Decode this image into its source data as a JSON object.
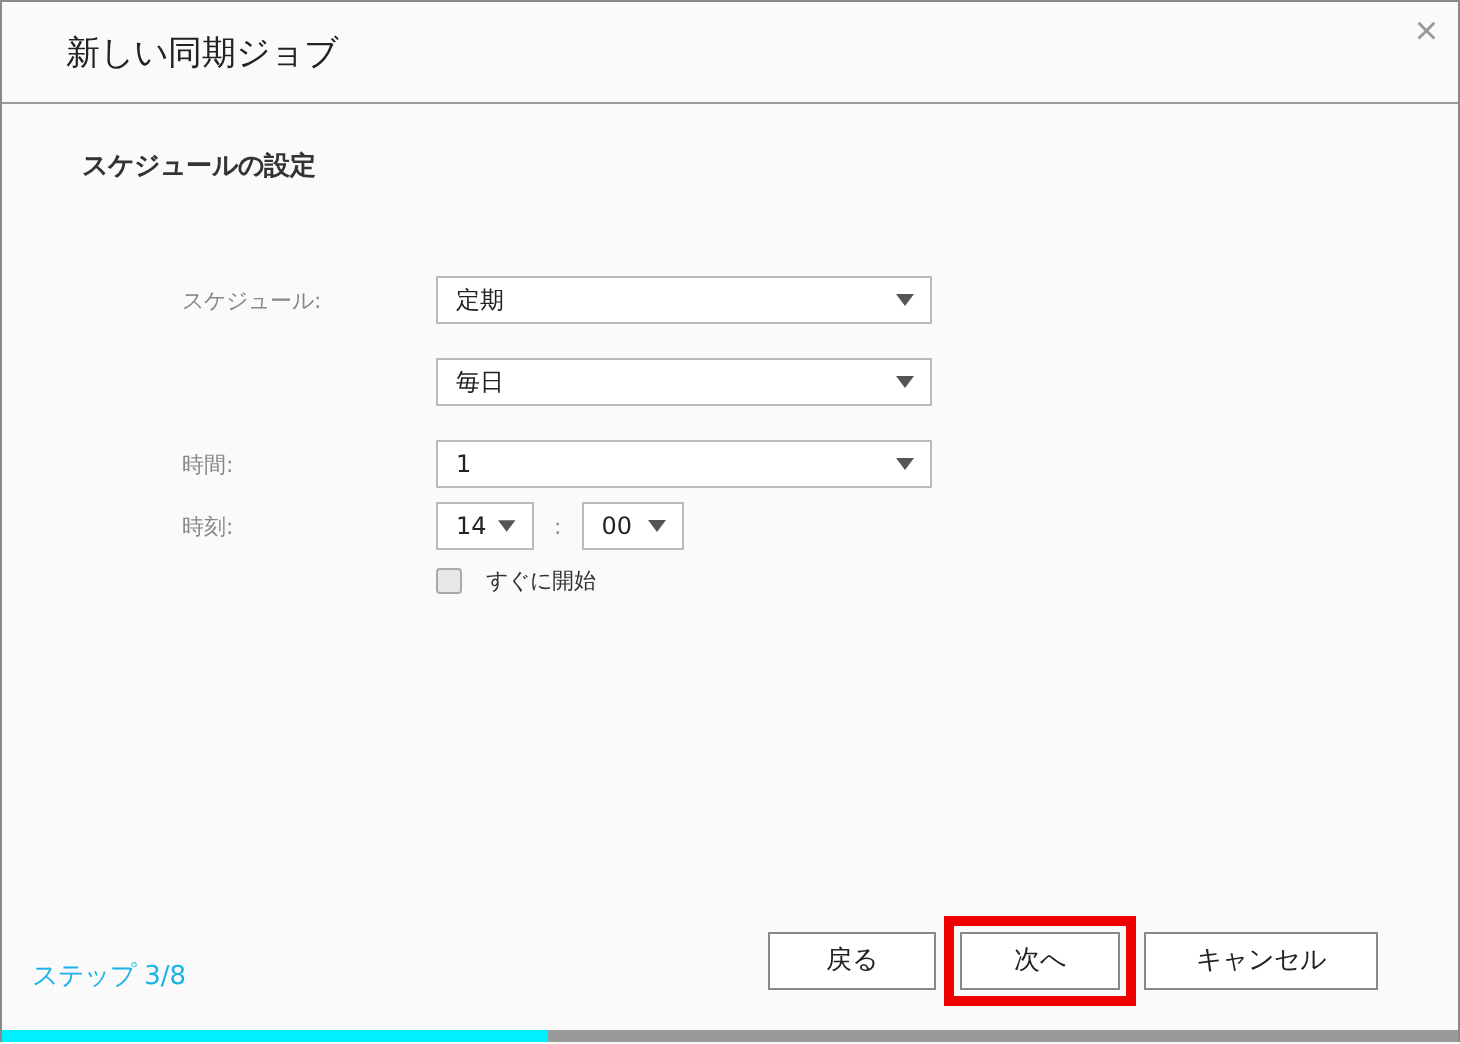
{
  "window": {
    "title": "新しい同期ジョブ",
    "close": "×"
  },
  "section_title": "スケジュールの設定",
  "form": {
    "rows": [
      {
        "kind": "select",
        "label": "スケジュール:",
        "value": "定期"
      },
      {
        "kind": "select",
        "value": "毎日"
      },
      {
        "kind": "select",
        "label": "時間:",
        "value": "1"
      },
      {
        "kind": "time",
        "label": "時刻:",
        "hour": "14",
        "separator": ":",
        "minute": "00"
      },
      {
        "kind": "checkbox",
        "label": "すぐに開始",
        "checked": false
      }
    ]
  },
  "footer": {
    "step": "ステップ 3/8",
    "buttons": [
      {
        "label": "戻る",
        "highlighted": false
      },
      {
        "label": "次へ",
        "highlighted": true
      },
      {
        "label": "キャンセル",
        "highlighted": false
      }
    ]
  },
  "progress": {
    "level": 0.375
  }
}
